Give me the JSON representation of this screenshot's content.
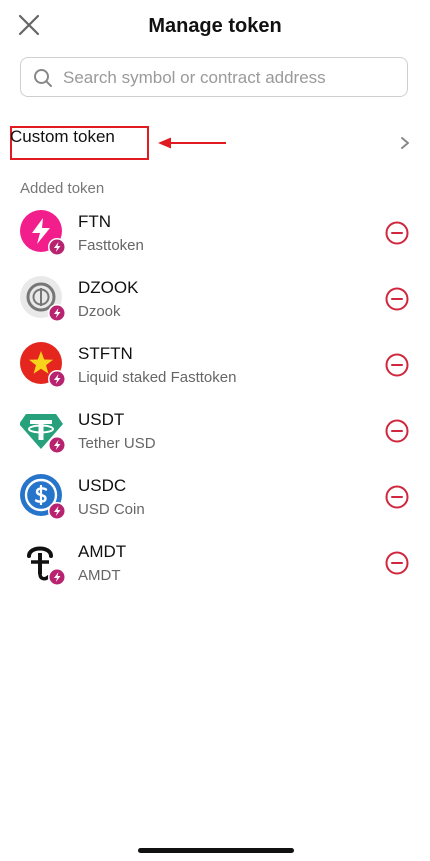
{
  "header": {
    "title": "Manage token",
    "close_icon": "close-icon"
  },
  "search": {
    "placeholder": "Search symbol or contract address",
    "value": "",
    "icon": "search-icon"
  },
  "custom_token": {
    "label": "Custom token",
    "chevron_icon": "chevron-right-icon",
    "annotation_color": "#e01b22"
  },
  "added_section": {
    "label": "Added token",
    "tokens": [
      {
        "symbol": "FTN",
        "name": "Fasttoken",
        "logo": "ftn-logo"
      },
      {
        "symbol": "DZOOK",
        "name": "Dzook",
        "logo": "dzook-logo"
      },
      {
        "symbol": "STFTN",
        "name": "Liquid staked Fasttoken",
        "logo": "stftn-logo"
      },
      {
        "symbol": "USDT",
        "name": "Tether USD",
        "logo": "usdt-logo"
      },
      {
        "symbol": "USDC",
        "name": "USD Coin",
        "logo": "usdc-logo"
      },
      {
        "symbol": "AMDT",
        "name": "AMDT",
        "logo": "amdt-logo"
      }
    ],
    "remove_icon": "minus-circle-icon",
    "badge_icon": "bolt-badge-icon"
  },
  "colors": {
    "remove": "#d0273d",
    "badge": "#b8236f",
    "ftn_pink": "#f21e8c",
    "annotation_red": "#e01b22"
  }
}
